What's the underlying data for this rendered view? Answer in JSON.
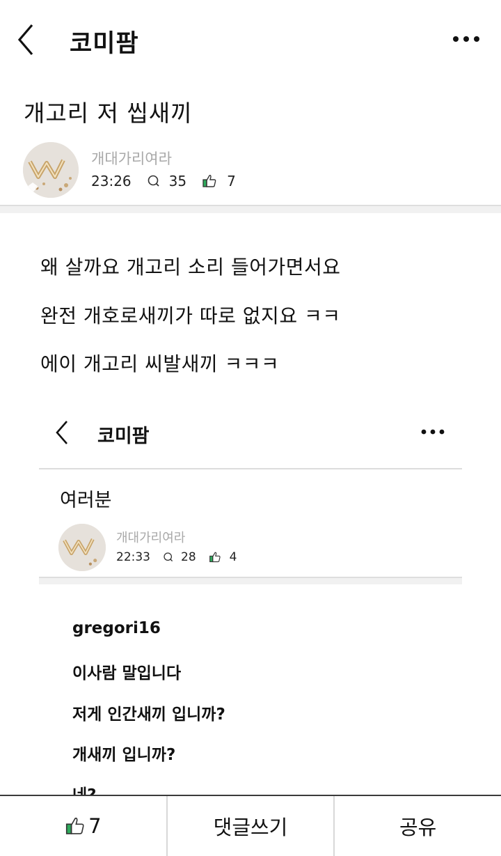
{
  "header": {
    "title": "코미팜"
  },
  "post": {
    "title": "개고리 저 씹새끼",
    "author": "개대가리여라",
    "time": "23:26",
    "comments": "35",
    "likes": "7",
    "body": [
      "왜 살까요 개고리 소리 들어가면서요",
      "완전 개호로새끼가 따로 없지요 ㅋㅋ",
      "에이 개고리 씨발새끼 ㅋㅋㅋ"
    ]
  },
  "embedded": {
    "header_title": "코미팜",
    "post_title": "여러분",
    "author": "개대가리여라",
    "time": "22:33",
    "comments": "28",
    "likes": "4",
    "lines": [
      "gregori16",
      "이사람 말입니다",
      "저게 인간새끼 입니까?",
      "개새끼 입니까?",
      "네?"
    ]
  },
  "bottom_bar": {
    "like_count": "7",
    "comment_label": "댓글쓰기",
    "share_label": "공유"
  },
  "colors": {
    "accent_like": "#2eaa5c",
    "muted_text": "#a8a8a8"
  }
}
